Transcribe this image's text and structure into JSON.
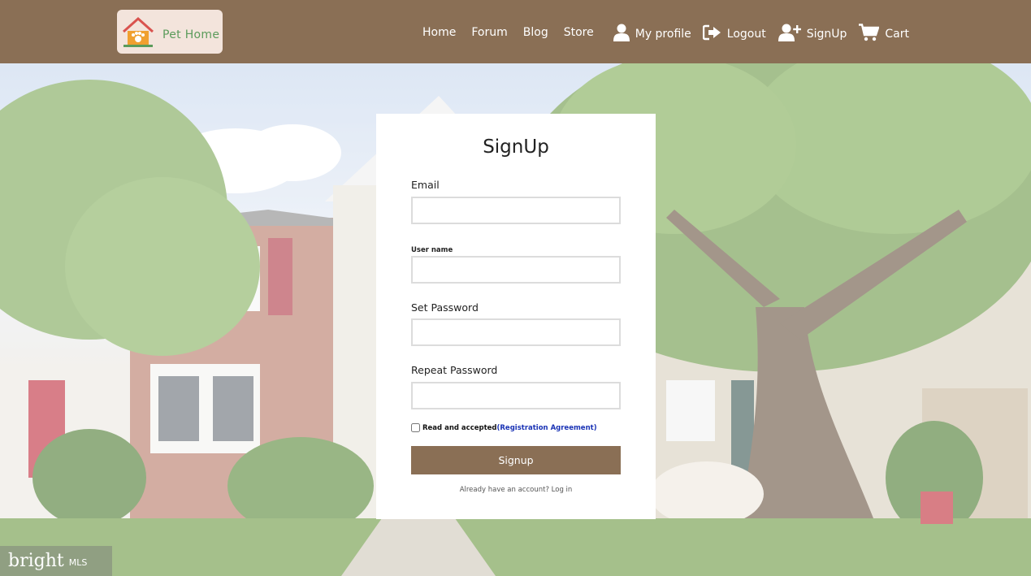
{
  "header": {
    "logo_text": "Pet Home",
    "nav": {
      "home": "Home",
      "forum": "Forum",
      "blog": "Blog",
      "store": "Store",
      "my_profile": "My profile",
      "logout": "Logout",
      "signup": "SignUp",
      "cart": "Cart"
    },
    "icons": {
      "my_profile": "user-icon",
      "logout": "sign-out-icon",
      "signup": "user-plus-icon",
      "cart": "shopping-cart-icon"
    }
  },
  "form": {
    "title": "SignUp",
    "email_label": "Email",
    "email_value": "",
    "username_label": "User name",
    "username_value": "",
    "password_label": "Set Password",
    "password_value": "",
    "repeat_password_label": "Repeat Password",
    "repeat_password_value": "",
    "agreement_text": "Read and accepted",
    "agreement_link": "(Registration Agreement)",
    "agreement_checked": false,
    "submit_label": "Signup",
    "login_hint": "Already have an account?",
    "login_link": "Log in"
  },
  "watermark": {
    "main": "bright",
    "sub": "MLS"
  },
  "colors": {
    "brand": "#8a6f55",
    "link": "#1a33b5",
    "logo_bg": "#f3e4dc"
  }
}
